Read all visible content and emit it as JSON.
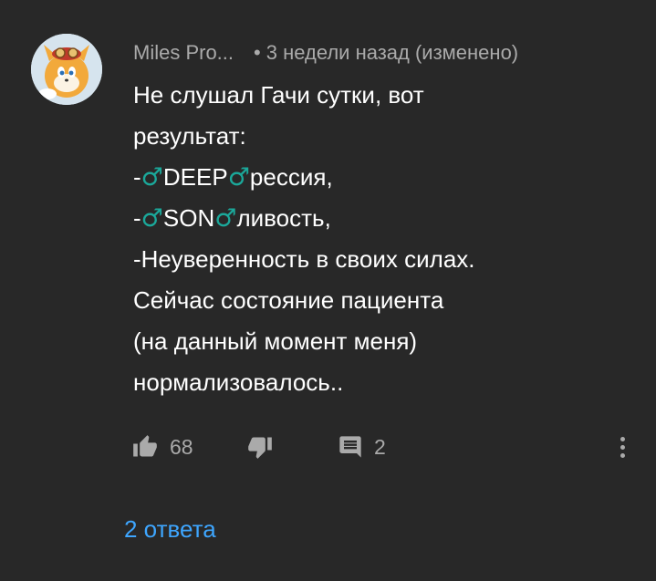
{
  "comment": {
    "author": "Miles Pro...",
    "separator": "•",
    "time": "3 недели назад (изменено)",
    "lines": [
      {
        "parts": [
          "Не слушал Гачи сутки, вот"
        ]
      },
      {
        "parts": [
          "результат:"
        ]
      },
      {
        "prefix": "-",
        "symbol": "♂",
        "word": "DEEP",
        "suffix": "рессия,"
      },
      {
        "prefix": "-",
        "symbol": "♂",
        "word": "SON",
        "suffix": "ливость,"
      },
      {
        "parts": [
          "-Неуверенность в своих силах."
        ]
      },
      {
        "parts": [
          "Сейчас состояние пациента"
        ]
      },
      {
        "parts": [
          "(на данный момент меня)"
        ]
      },
      {
        "parts": [
          "нормализовалось.."
        ]
      }
    ],
    "line1": "Не слушал Гачи сутки, вот",
    "line2": "результат:",
    "line3_prefix": "-",
    "line3_word": "DEEP",
    "line3_suffix": "рессия,",
    "line4_prefix": "-",
    "line4_word": "SON",
    "line4_suffix": "ливость,",
    "line5": "-Неуверенность в своих силах.",
    "line6": "Сейчас состояние пациента",
    "line7": "(на данный момент меня)",
    "line8": "нормализовалось..",
    "male_symbol": "♂",
    "likes": "68",
    "replies_count": "2",
    "replies_link": "2 ответа"
  },
  "icons": {
    "like": "thumb-up-icon",
    "dislike": "thumb-down-icon",
    "reply": "comment-icon",
    "more": "more-vert-icon"
  },
  "colors": {
    "background": "#282828",
    "text": "#ffffff",
    "muted": "#aaaaaa",
    "male_symbol": "#1ba89a",
    "link": "#3ea6ff"
  }
}
